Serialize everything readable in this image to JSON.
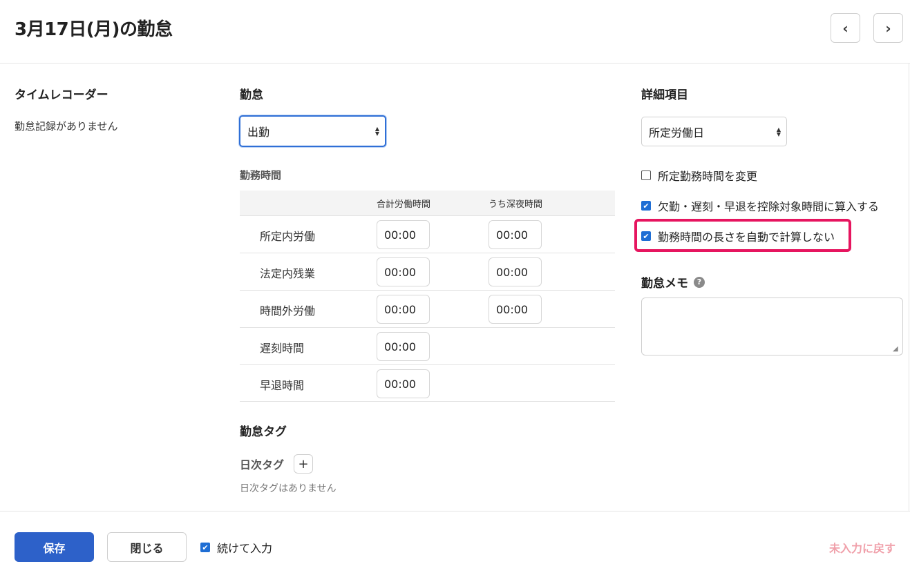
{
  "header": {
    "title": "3月17日(月)の勤怠",
    "prev_icon": "‹",
    "next_icon": "›"
  },
  "time_recorder": {
    "heading": "タイムレコーダー",
    "empty_text": "勤怠記録がありません"
  },
  "attendance": {
    "heading": "勤怠",
    "selected": "出勤",
    "work_time_heading": "勤務時間",
    "columns": [
      "",
      "合計労働時間",
      "うち深夜時間"
    ],
    "rows": [
      {
        "label": "所定内労働",
        "total": "00:00",
        "night": "00:00"
      },
      {
        "label": "法定内残業",
        "total": "00:00",
        "night": "00:00"
      },
      {
        "label": "時間外労働",
        "total": "00:00",
        "night": "00:00"
      },
      {
        "label": "遅刻時間",
        "total": "00:00"
      },
      {
        "label": "早退時間",
        "total": "00:00"
      }
    ]
  },
  "tags": {
    "heading": "勤怠タグ",
    "daily_heading": "日次タグ",
    "add_icon": "+",
    "empty_text": "日次タグはありません"
  },
  "details": {
    "heading": "詳細項目",
    "selected": "所定労働日",
    "checkboxes": [
      {
        "label": "所定勤務時間を変更",
        "checked": false
      },
      {
        "label": "欠勤・遅刻・早退を控除対象時間に算入する",
        "checked": true
      },
      {
        "label": "勤務時間の長さを自動で計算しない",
        "checked": true
      }
    ],
    "highlight_color": "#e6155f"
  },
  "memo": {
    "heading": "勤怠メモ",
    "help_icon": "?",
    "value": ""
  },
  "footer": {
    "save_label": "保存",
    "close_label": "閉じる",
    "continue_label": "続けて入力",
    "continue_checked": true,
    "reset_label": "未入力に戻す"
  },
  "colors": {
    "primary": "#2d61c9",
    "checkbox": "#1f6ed4",
    "reset_link": "#f0a0aa"
  }
}
